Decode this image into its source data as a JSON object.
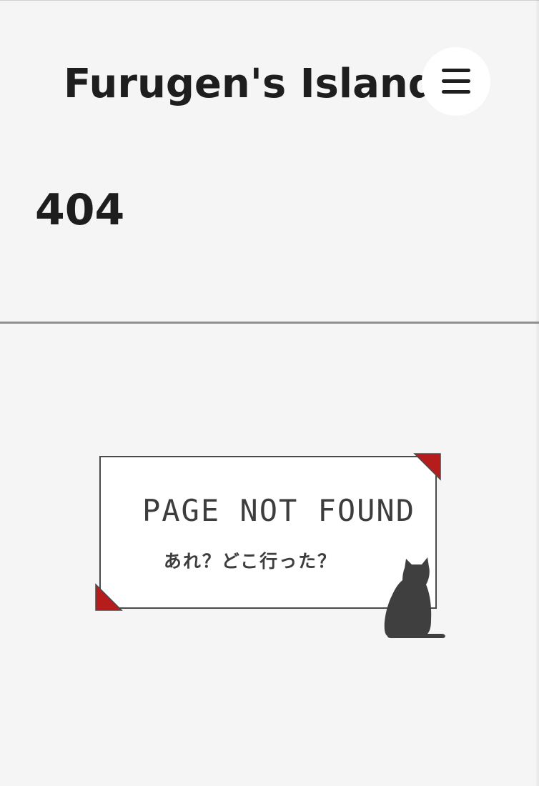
{
  "header": {
    "site_title": "Furugen's Island",
    "menu_icon": "hamburger-menu-icon"
  },
  "main": {
    "heading": "404"
  },
  "not_found": {
    "title": "PAGE NOT FOUND",
    "subtitle": "あれ？どこ行った？",
    "corner_color": "#b71c1c",
    "cat_color": "#3f3f3f"
  },
  "colors": {
    "background": "#f5f5f5",
    "text": "#1e1e1e",
    "divider": "#8e8e8e"
  }
}
